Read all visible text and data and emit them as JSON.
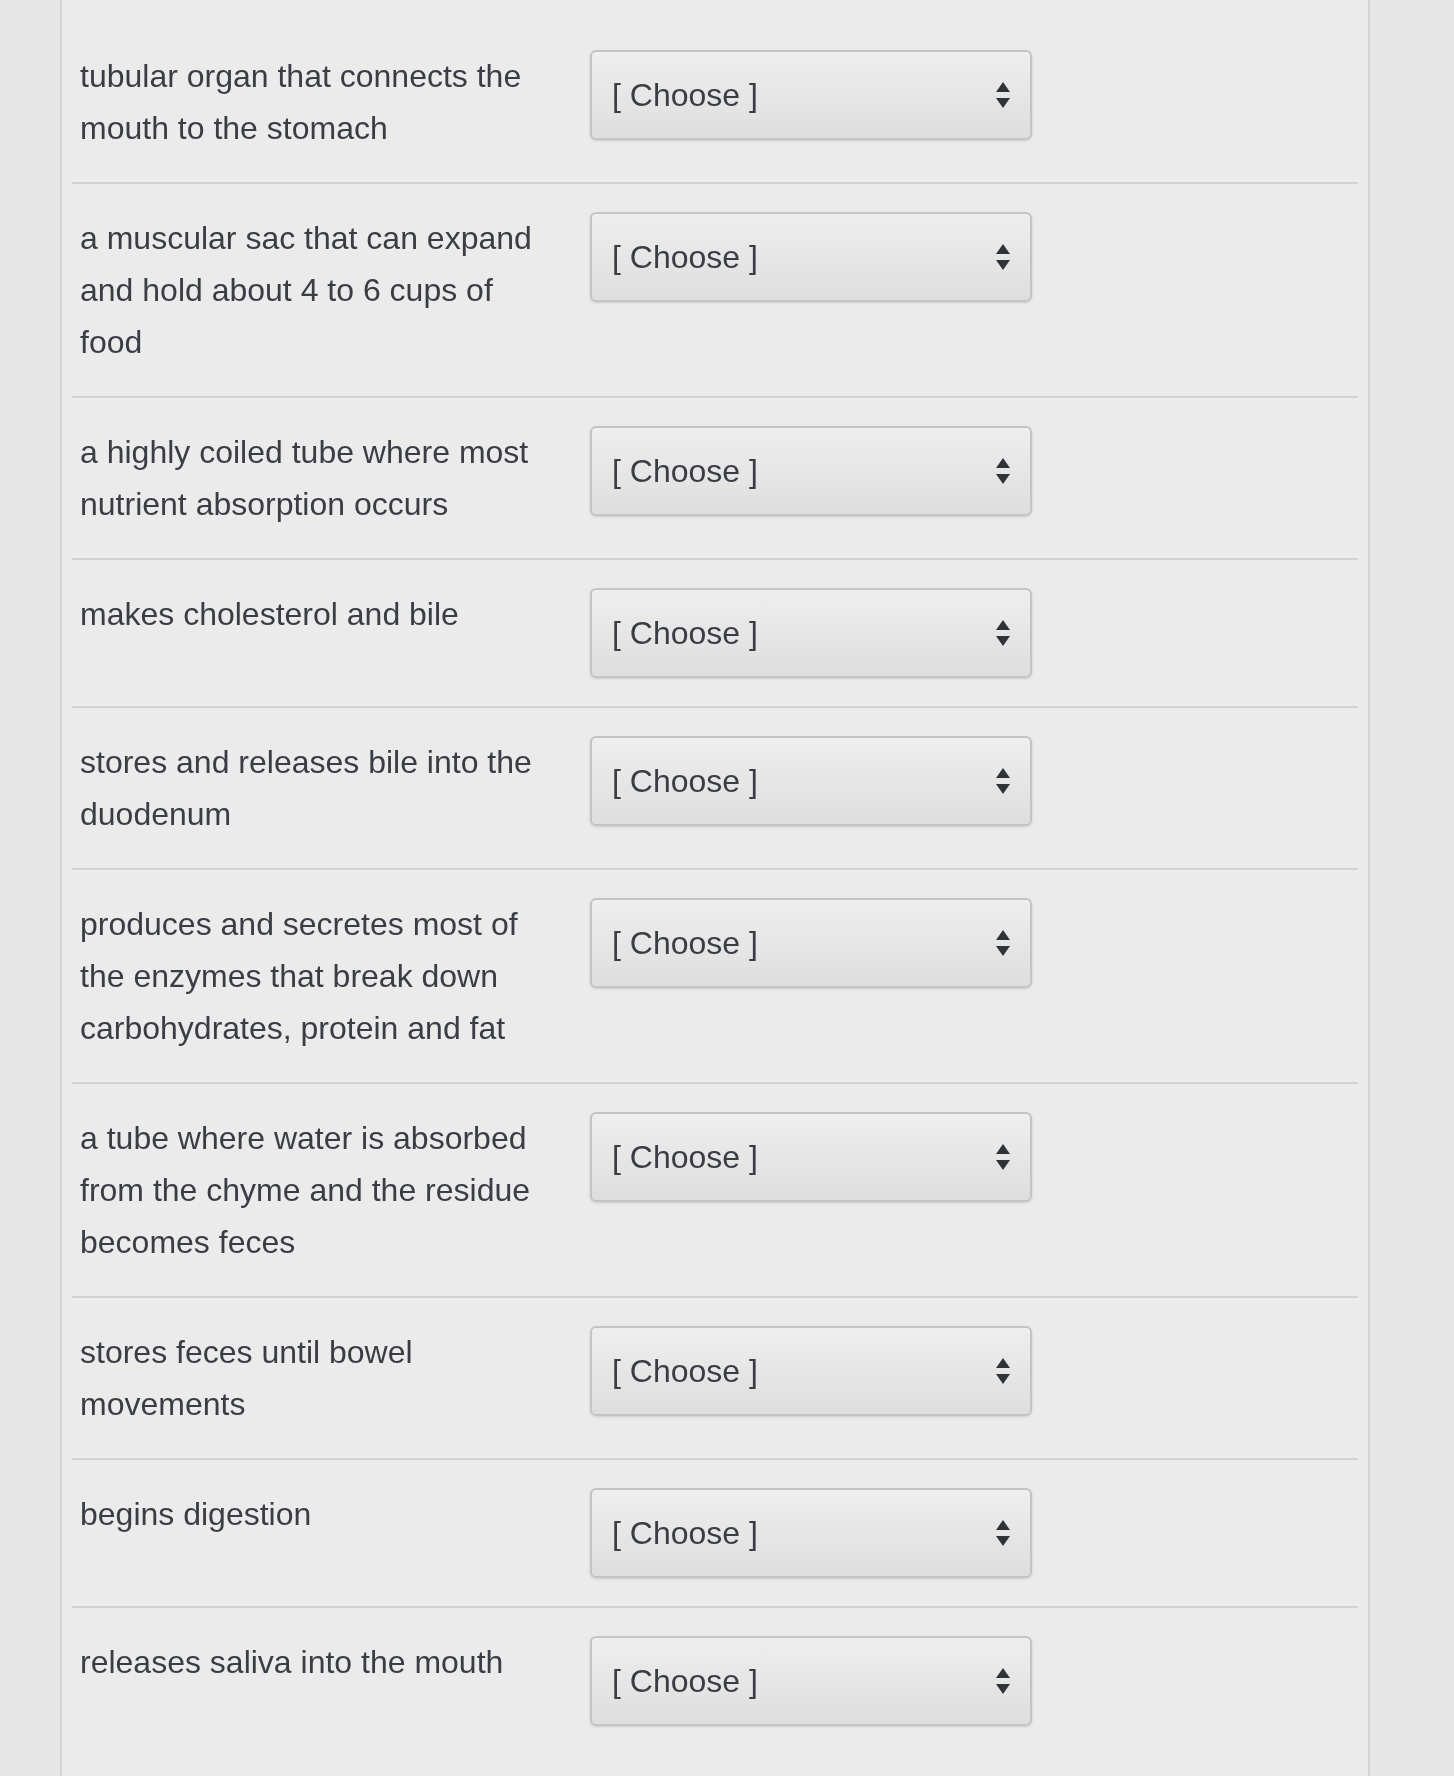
{
  "questions": [
    {
      "prompt": "tubular organ that connects the mouth to the stomach",
      "answer": "[ Choose ]"
    },
    {
      "prompt": "a muscular sac that can expand and hold about 4 to 6 cups of food",
      "answer": "[ Choose ]"
    },
    {
      "prompt": "a highly coiled tube where most nutrient absorption occurs",
      "answer": "[ Choose ]"
    },
    {
      "prompt": "makes cholesterol and bile",
      "answer": "[ Choose ]"
    },
    {
      "prompt": "stores and releases bile into the duodenum",
      "answer": "[ Choose ]"
    },
    {
      "prompt": "produces and secretes most of the enzymes that break down carbohydrates, protein and fat",
      "answer": "[ Choose ]"
    },
    {
      "prompt": "a tube where water is absorbed from the chyme and the residue becomes feces",
      "answer": "[ Choose ]"
    },
    {
      "prompt": "stores feces until bowel movements",
      "answer": "[ Choose ]"
    },
    {
      "prompt": "begins digestion",
      "answer": "[ Choose ]"
    },
    {
      "prompt": "releases saliva into the mouth",
      "answer": "[ Choose ]"
    }
  ]
}
